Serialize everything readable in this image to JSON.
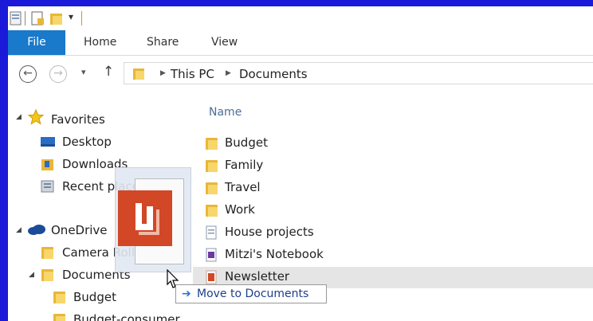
{
  "ribbon": {
    "tabs": [
      {
        "label": "File"
      },
      {
        "label": "Home"
      },
      {
        "label": "Share"
      },
      {
        "label": "View"
      }
    ]
  },
  "address": {
    "crumbs": [
      "This PC",
      "Documents"
    ]
  },
  "nav": {
    "favorites_label": "Favorites",
    "favorites": [
      "Desktop",
      "Downloads",
      "Recent places"
    ],
    "onedrive_label": "OneDrive",
    "onedrive_items": [
      "Camera Roll",
      "Documents"
    ],
    "documents_children": [
      "Budget",
      "Budget-consumer"
    ]
  },
  "content": {
    "column_name": "Name",
    "files": [
      {
        "name": "Budget",
        "icon": "folder-icon"
      },
      {
        "name": "Family",
        "icon": "folder-icon"
      },
      {
        "name": "Travel",
        "icon": "folder-icon"
      },
      {
        "name": "Work",
        "icon": "folder-icon"
      },
      {
        "name": "House projects",
        "icon": "document-icon"
      },
      {
        "name": "Mitzi's Notebook",
        "icon": "notebook-icon"
      },
      {
        "name": "Newsletter",
        "icon": "publisher-icon"
      }
    ]
  },
  "drag": {
    "tooltip": "Move to Documents"
  },
  "colors": {
    "frame": "#1a1ad8",
    "file_tab": "#1979ca",
    "folder": "#e8b73a",
    "publisher": "#d24726",
    "selected_row": "#e5e5e5"
  }
}
